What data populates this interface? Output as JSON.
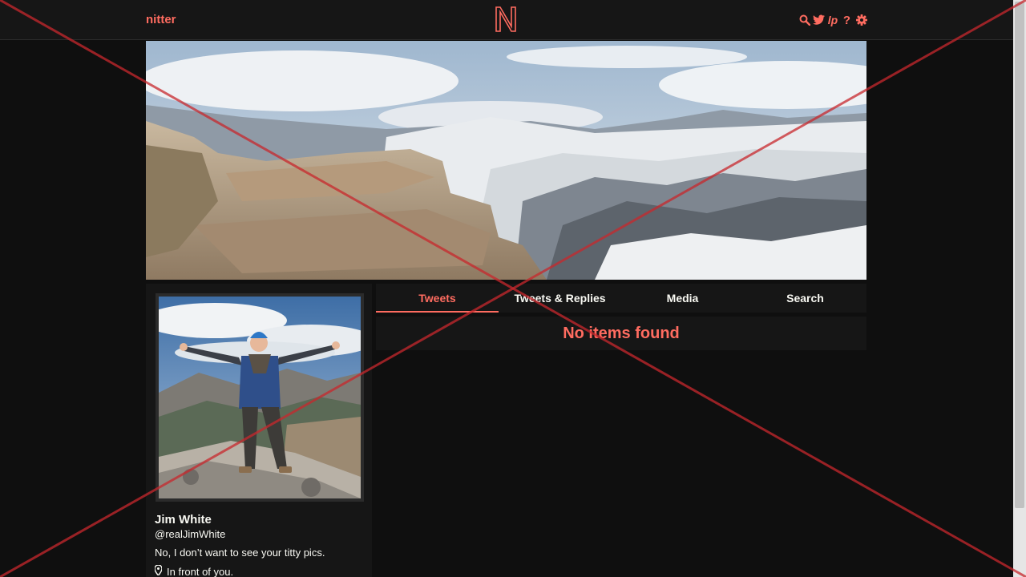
{
  "nav": {
    "brand": "nitter",
    "logo_letter": "N",
    "icons": [
      "search-icon",
      "twitter-icon",
      "liberapay-icon",
      "help-icon",
      "gear-icon"
    ],
    "lp_glyph": "lp",
    "help_glyph": "?"
  },
  "tabs": [
    {
      "label": "Tweets",
      "active": true
    },
    {
      "label": "Tweets & Replies",
      "active": false
    },
    {
      "label": "Media",
      "active": false
    },
    {
      "label": "Search",
      "active": false
    }
  ],
  "timeline": {
    "empty_message": "No items found"
  },
  "profile": {
    "name": "Jim White",
    "handle": "@realJimWhite",
    "bio": "No, I don’t want to see your titty pics.",
    "location": "In front of you."
  },
  "colors": {
    "accent": "#ff6c60",
    "background": "#0f0f0f",
    "panel": "#161616",
    "overlay": "#c8282d"
  }
}
